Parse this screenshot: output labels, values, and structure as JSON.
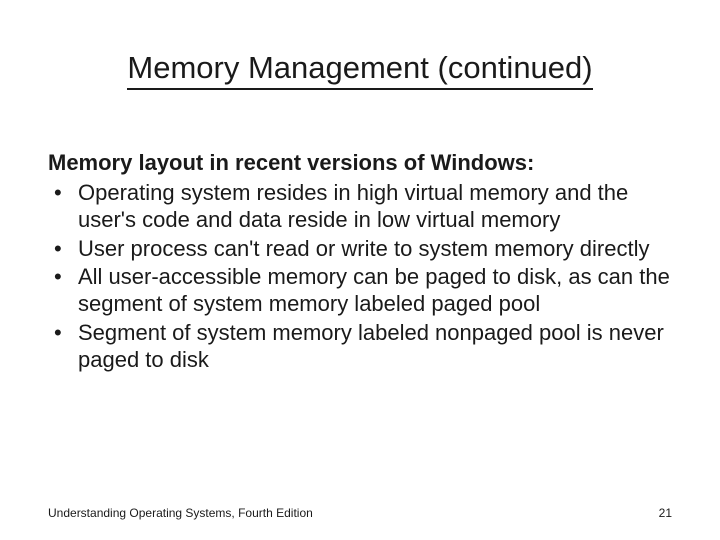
{
  "title": "Memory Management (continued)",
  "subheading": "Memory layout in recent versions of Windows:",
  "bullets": [
    "Operating system resides in high virtual memory and the user's code and data reside in low virtual memory",
    "User process can't read or write to system memory directly",
    "All user-accessible memory can be paged to disk, as can the segment of system memory labeled paged pool",
    "Segment of system memory labeled nonpaged pool is never paged to disk"
  ],
  "footer": {
    "left": "Understanding Operating Systems, Fourth Edition",
    "right": "21"
  }
}
